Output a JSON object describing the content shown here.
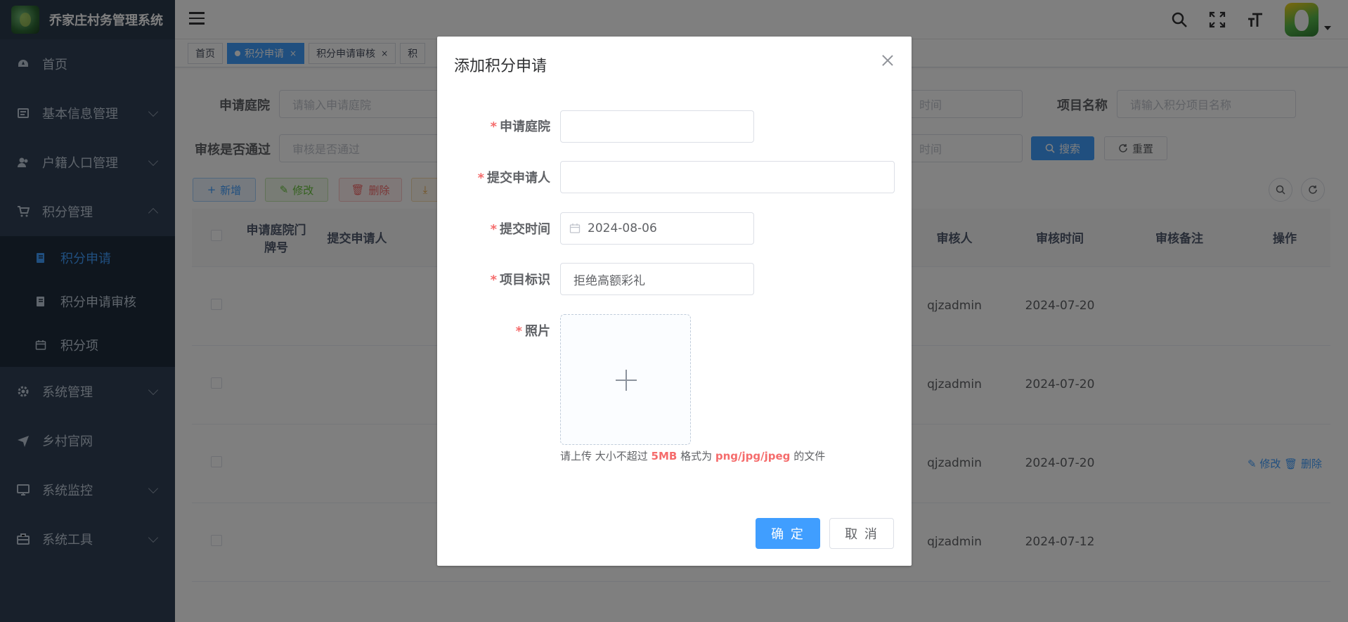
{
  "app": {
    "title": "乔家庄村务管理系统"
  },
  "sidebar": {
    "items": [
      {
        "label": "首页",
        "icon": "dashboard-icon"
      },
      {
        "label": "基本信息管理",
        "icon": "info-icon"
      },
      {
        "label": "户籍人口管理",
        "icon": "user-icon"
      },
      {
        "label": "积分管理",
        "icon": "cart-icon"
      },
      {
        "label": "系统管理",
        "icon": "gear-icon"
      },
      {
        "label": "乡村官网",
        "icon": "send-icon"
      },
      {
        "label": "系统监控",
        "icon": "monitor-icon"
      },
      {
        "label": "系统工具",
        "icon": "toolbox-icon"
      }
    ],
    "submenu": [
      {
        "label": "积分申请",
        "active": true
      },
      {
        "label": "积分申请审核",
        "active": false
      },
      {
        "label": "积分项",
        "active": false
      }
    ]
  },
  "tags": [
    {
      "label": "首页",
      "active": false
    },
    {
      "label": "积分申请",
      "active": true
    },
    {
      "label": "积分申请审核",
      "active": false
    },
    {
      "label": "积",
      "active": false
    }
  ],
  "search": {
    "label1": "申请庭院",
    "placeholder1": "请输入申请庭院",
    "label2": "审核是否通过",
    "placeholder2": "审核是否通过",
    "time_placeholder": "时间",
    "label3": "项目名称",
    "placeholder3": "请输入积分项目名称",
    "search_btn": "搜索",
    "reset_btn": "重置"
  },
  "toolbar": {
    "add": "新增",
    "edit": "修改",
    "delete": "删除"
  },
  "table": {
    "headers": [
      "申请庭院门牌号",
      "提交申请人",
      "审核人",
      "审核时间",
      "审核备注",
      "操作"
    ],
    "rows": [
      {
        "auditor": "qjzadmin",
        "time": "2024-07-20"
      },
      {
        "auditor": "qjzadmin",
        "time": "2024-07-20"
      },
      {
        "auditor": "qjzadmin",
        "time": "2024-07-20",
        "edit": "修改",
        "delete": "删除"
      },
      {
        "auditor": "qjzadmin",
        "time": "2024-07-12"
      }
    ]
  },
  "dialog": {
    "title": "添加积分申请",
    "fields": {
      "courtyard": {
        "label": "申请庭院",
        "value": ""
      },
      "applicant": {
        "label": "提交申请人",
        "value": ""
      },
      "submit_time": {
        "label": "提交时间",
        "value": "2024-08-06"
      },
      "item": {
        "label": "项目标识",
        "value": "拒绝高额彩礼"
      },
      "photo": {
        "label": "照片"
      }
    },
    "tip": {
      "pre": "请上传 大小不超过 ",
      "size": "5MB",
      "mid": " 格式为 ",
      "formats": "png/jpg/jpeg",
      "post": " 的文件"
    },
    "confirm": "确 定",
    "cancel": "取 消"
  },
  "colors": {
    "primary": "#409eff",
    "sidebar": "#304156",
    "danger": "#f56c6c"
  }
}
